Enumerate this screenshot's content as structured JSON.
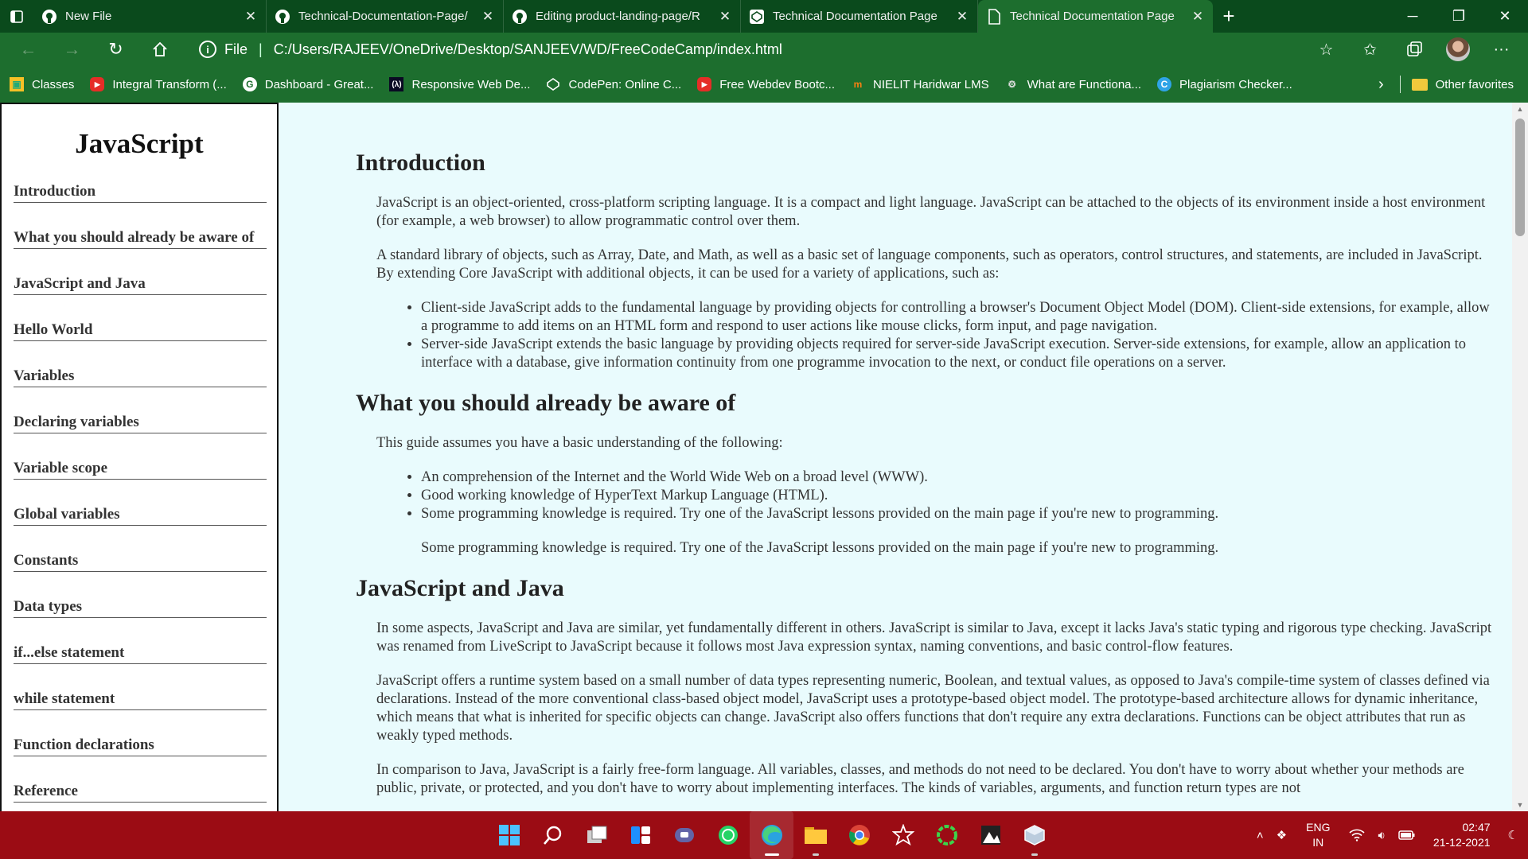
{
  "browser": {
    "tabs": [
      {
        "title": "New File",
        "icon": "github-icon",
        "active": false
      },
      {
        "title": "Technical-Documentation-Page/",
        "icon": "github-icon",
        "active": false
      },
      {
        "title": "Editing product-landing-page/R",
        "icon": "github-icon",
        "active": false
      },
      {
        "title": "Technical Documentation Page",
        "icon": "codepen-icon",
        "active": false
      },
      {
        "title": "Technical Documentation Page",
        "icon": "file-icon",
        "active": true
      }
    ],
    "address": {
      "scheme_label": "File",
      "url": "C:/Users/RAJEEV/OneDrive/Desktop/SANJEEV/WD/FreeCodeCamp/index.html"
    },
    "favorites": [
      {
        "label": "Classes",
        "icon": "classroom-icon"
      },
      {
        "label": "Integral Transform (...",
        "icon": "youtube-icon"
      },
      {
        "label": "Dashboard - Great...",
        "icon": "google-icon"
      },
      {
        "label": "Responsive Web De...",
        "icon": "fcc-icon"
      },
      {
        "label": "CodePen: Online C...",
        "icon": "codepen-icon"
      },
      {
        "label": "Free Webdev Bootc...",
        "icon": "youtube-icon"
      },
      {
        "label": "NIELIT Haridwar LMS",
        "icon": "moodle-icon"
      },
      {
        "label": "What are Functiona...",
        "icon": "site-icon"
      },
      {
        "label": "Plagiarism Checker...",
        "icon": "checker-icon"
      }
    ],
    "other_favorites": "Other favorites"
  },
  "sidebar": {
    "title": "JavaScript",
    "links": [
      "Introduction",
      "What you should already be aware of",
      "JavaScript and Java",
      "Hello World",
      "Variables",
      "Declaring variables",
      "Variable scope",
      "Global variables",
      "Constants",
      "Data types",
      "if...else statement",
      "while statement",
      "Function declarations",
      "Reference"
    ]
  },
  "content": {
    "intro": {
      "heading": "Introduction",
      "p1": "JavaScript is an object-oriented, cross-platform scripting language. It is a compact and light language. JavaScript can be attached to the objects of its environment inside a host environment (for example, a web browser) to allow programmatic control over them.",
      "p2": "A standard library of objects, such as Array, Date, and Math, as well as a basic set of language components, such as operators, control structures, and statements, are included in JavaScript. By extending Core JavaScript with additional objects, it can be used for a variety of applications, such as:",
      "li1": "Client-side JavaScript adds to the fundamental language by providing objects for controlling a browser's Document Object Model (DOM). Client-side extensions, for example, allow a programme to add items on an HTML form and respond to user actions like mouse clicks, form input, and page navigation.",
      "li2": "Server-side JavaScript extends the basic language by providing objects required for server-side JavaScript execution. Server-side extensions, for example, allow an application to interface with a database, give information continuity from one programme invocation to the next, or conduct file operations on a server."
    },
    "aware": {
      "heading": "What you should already be aware of",
      "p1": "This guide assumes you have a basic understanding of the following:",
      "li1": "An comprehension of the Internet and the World Wide Web on a broad level (WWW).",
      "li2": "Good working knowledge of HyperText Markup Language (HTML).",
      "li3": "Some programming knowledge is required. Try one of the JavaScript lessons provided on the main page if you're new to programming.",
      "p2": "Some programming knowledge is required. Try one of the JavaScript lessons provided on the main page if you're new to programming."
    },
    "java": {
      "heading": "JavaScript and Java",
      "p1": "In some aspects, JavaScript and Java are similar, yet fundamentally different in others. JavaScript is similar to Java, except it lacks Java's static typing and rigorous type checking. JavaScript was renamed from LiveScript to JavaScript because it follows most Java expression syntax, naming conventions, and basic control-flow features.",
      "p2": "JavaScript offers a runtime system based on a small number of data types representing numeric, Boolean, and textual values, as opposed to Java's compile-time system of classes defined via declarations. Instead of the more conventional class-based object model, JavaScript uses a prototype-based object model. The prototype-based architecture allows for dynamic inheritance, which means that what is inherited for specific objects can change. JavaScript also offers functions that don't require any extra declarations. Functions can be object attributes that run as weakly typed methods.",
      "p3": "In comparison to Java, JavaScript is a fairly free-form language. All variables, classes, and methods do not need to be declared. You don't have to worry about whether your methods are public, private, or protected, and you don't have to worry about implementing interfaces. The kinds of variables, arguments, and function return types are not"
    }
  },
  "taskbar": {
    "apps": [
      "windows-start-icon",
      "search-icon",
      "task-view-icon",
      "widgets-icon",
      "teams-chat-icon",
      "whatsapp-icon",
      "edge-icon",
      "file-explorer-icon",
      "chrome-icon",
      "app-icon",
      "circle-app-icon",
      "photo-app-icon",
      "virtualbox-icon"
    ],
    "lang_line1": "ENG",
    "lang_line2": "IN",
    "time": "02:47",
    "date": "21-12-2021"
  },
  "colors": {
    "tabbar": "#0a4a1c",
    "toolbar": "#1d6e2e",
    "page_bg": "#e9fbfd",
    "taskbar": "#9b0c14"
  }
}
